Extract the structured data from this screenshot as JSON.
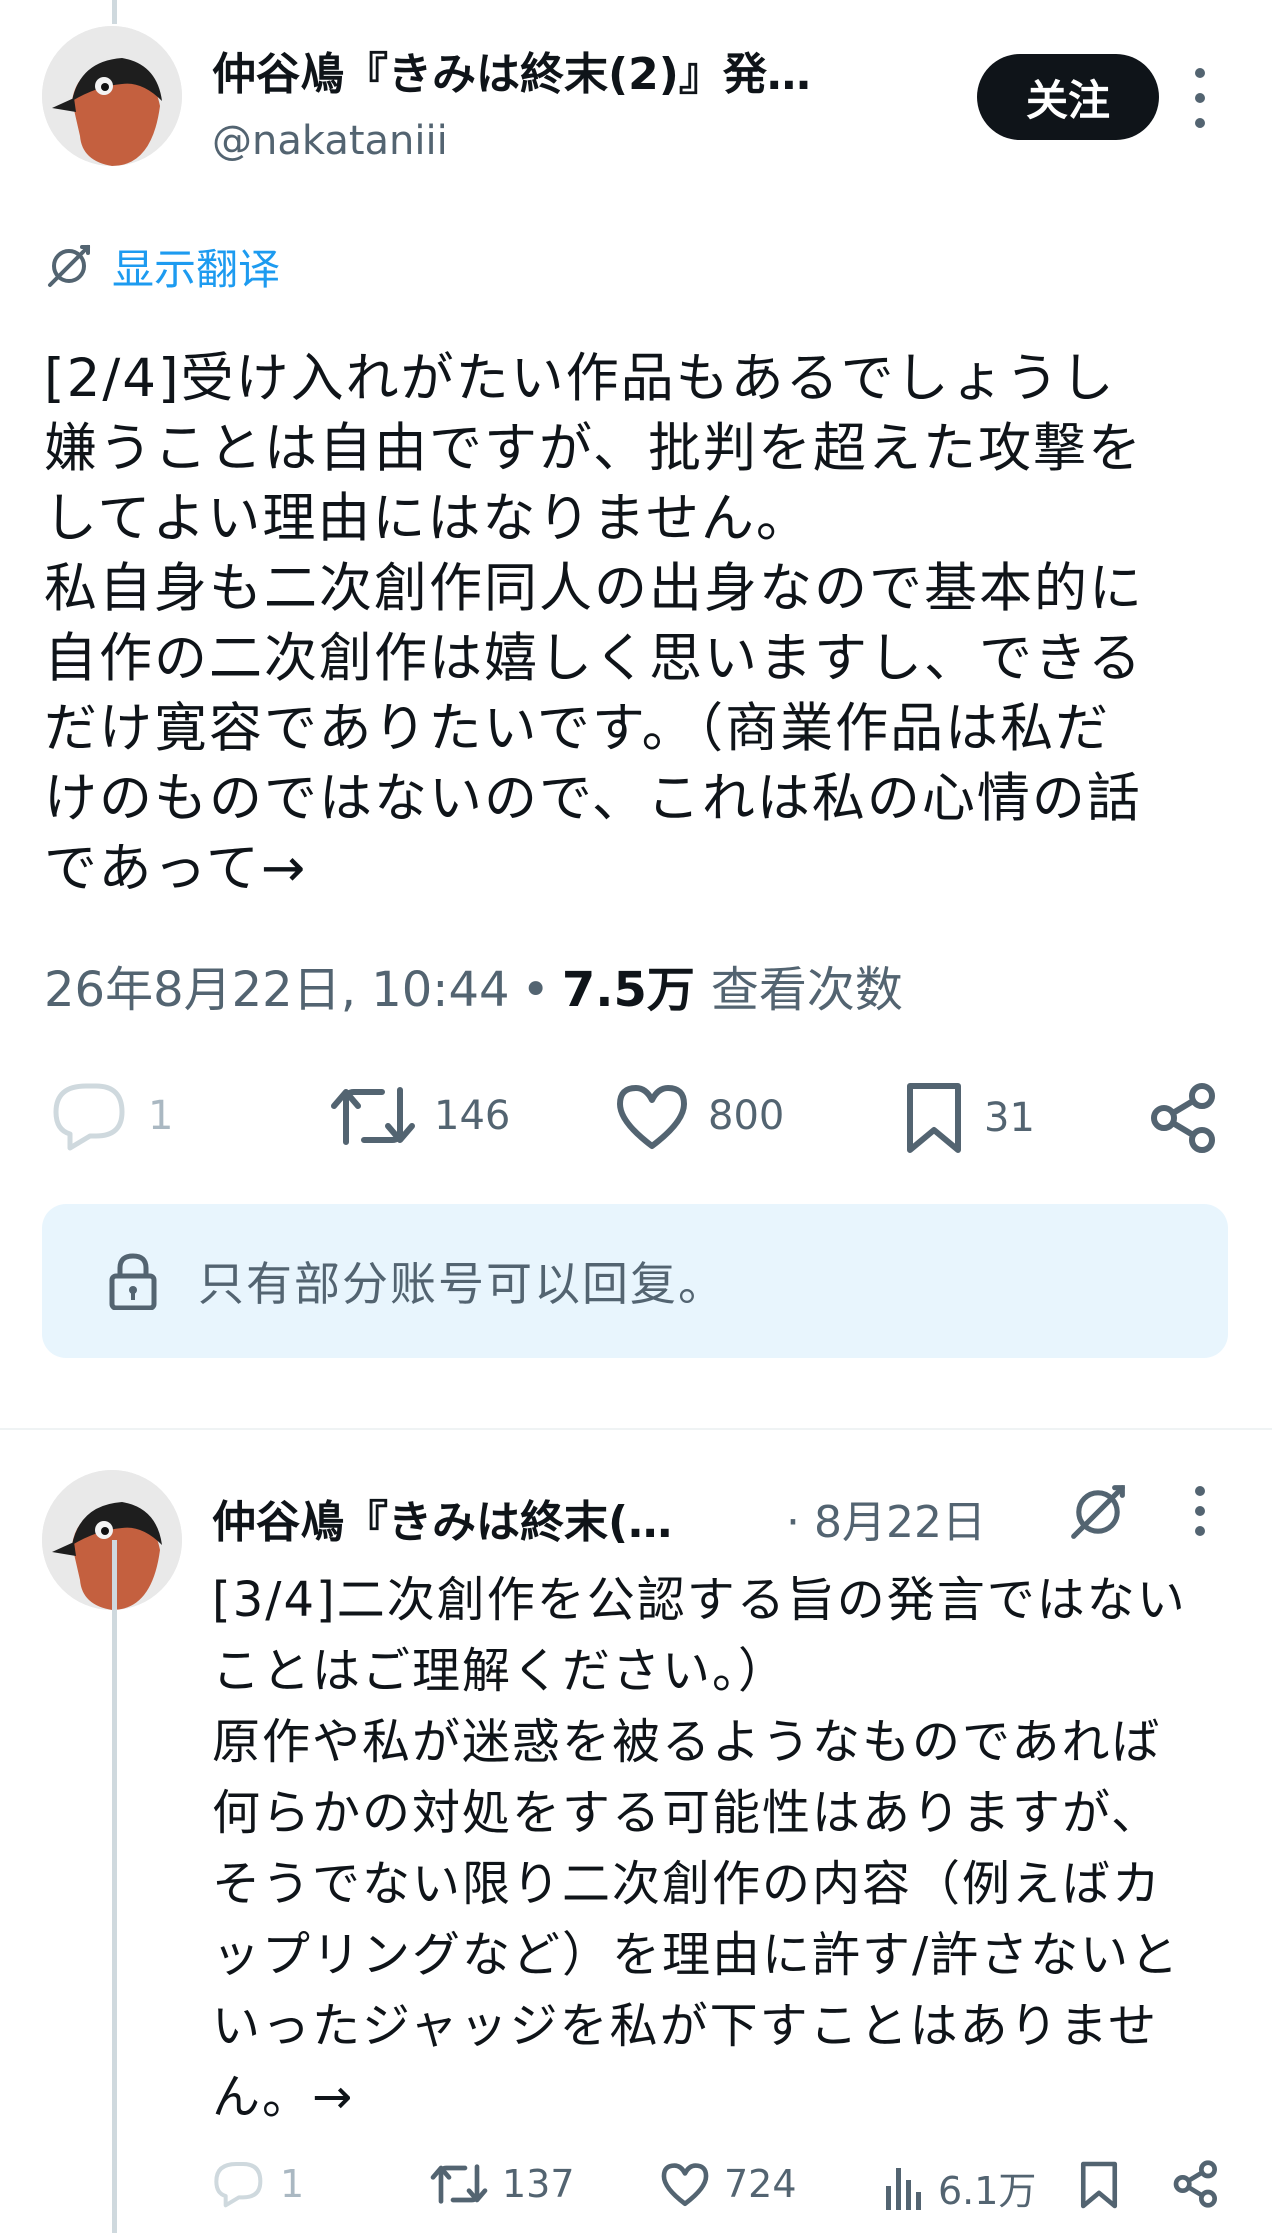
{
  "tweet_main": {
    "author": {
      "display_name": "仲谷鳰『きみは終末(2)』発…",
      "handle": "@nakataniii"
    },
    "follow_label": "关注",
    "translate_label": "显示翻译",
    "text": "[2/4]受け入れがたい作品もあるでしょうし\n嫌うことは自由ですが、批判を超えた攻撃を\nしてよい理由にはなりません。\n私自身も二次創作同人の出身なので基本的に\n自作の二次創作は嬉しく思いますし、できる\nだけ寛容でありたいです。（商業作品は私だ\nけのものではないので、これは私の心情の話\nであって→",
    "timestamp": "26年8月22日, 10:44",
    "separator": "•",
    "views_count": "7.5万",
    "views_label": "查看次数",
    "actions": {
      "replies": "1",
      "retweets": "146",
      "likes": "800",
      "bookmarks": "31"
    },
    "reply_restriction": "只有部分账号可以回复。"
  },
  "tweet_second": {
    "author": {
      "display_name": "仲谷鳰『きみは終末(…"
    },
    "date": "· 8月22日",
    "text": "[3/4]二次創作を公認する旨の発言ではない\nことはご理解ください。）\n原作や私が迷惑を被るようなものであれば\n何らかの対処をする可能性はありますが、\nそうでない限り二次創作の内容（例えばカ\nップリングなど）を理由に許す/許さないと\nいったジャッジを私が下すことはありませ\nん。→",
    "actions": {
      "replies": "1",
      "retweets": "137",
      "likes": "724",
      "views": "6.1万"
    }
  },
  "colors": {
    "text_primary": "#0f1419",
    "text_secondary": "#536471",
    "accent_blue": "#1d9bf0",
    "reply_box_bg": "#e8f5fd"
  }
}
